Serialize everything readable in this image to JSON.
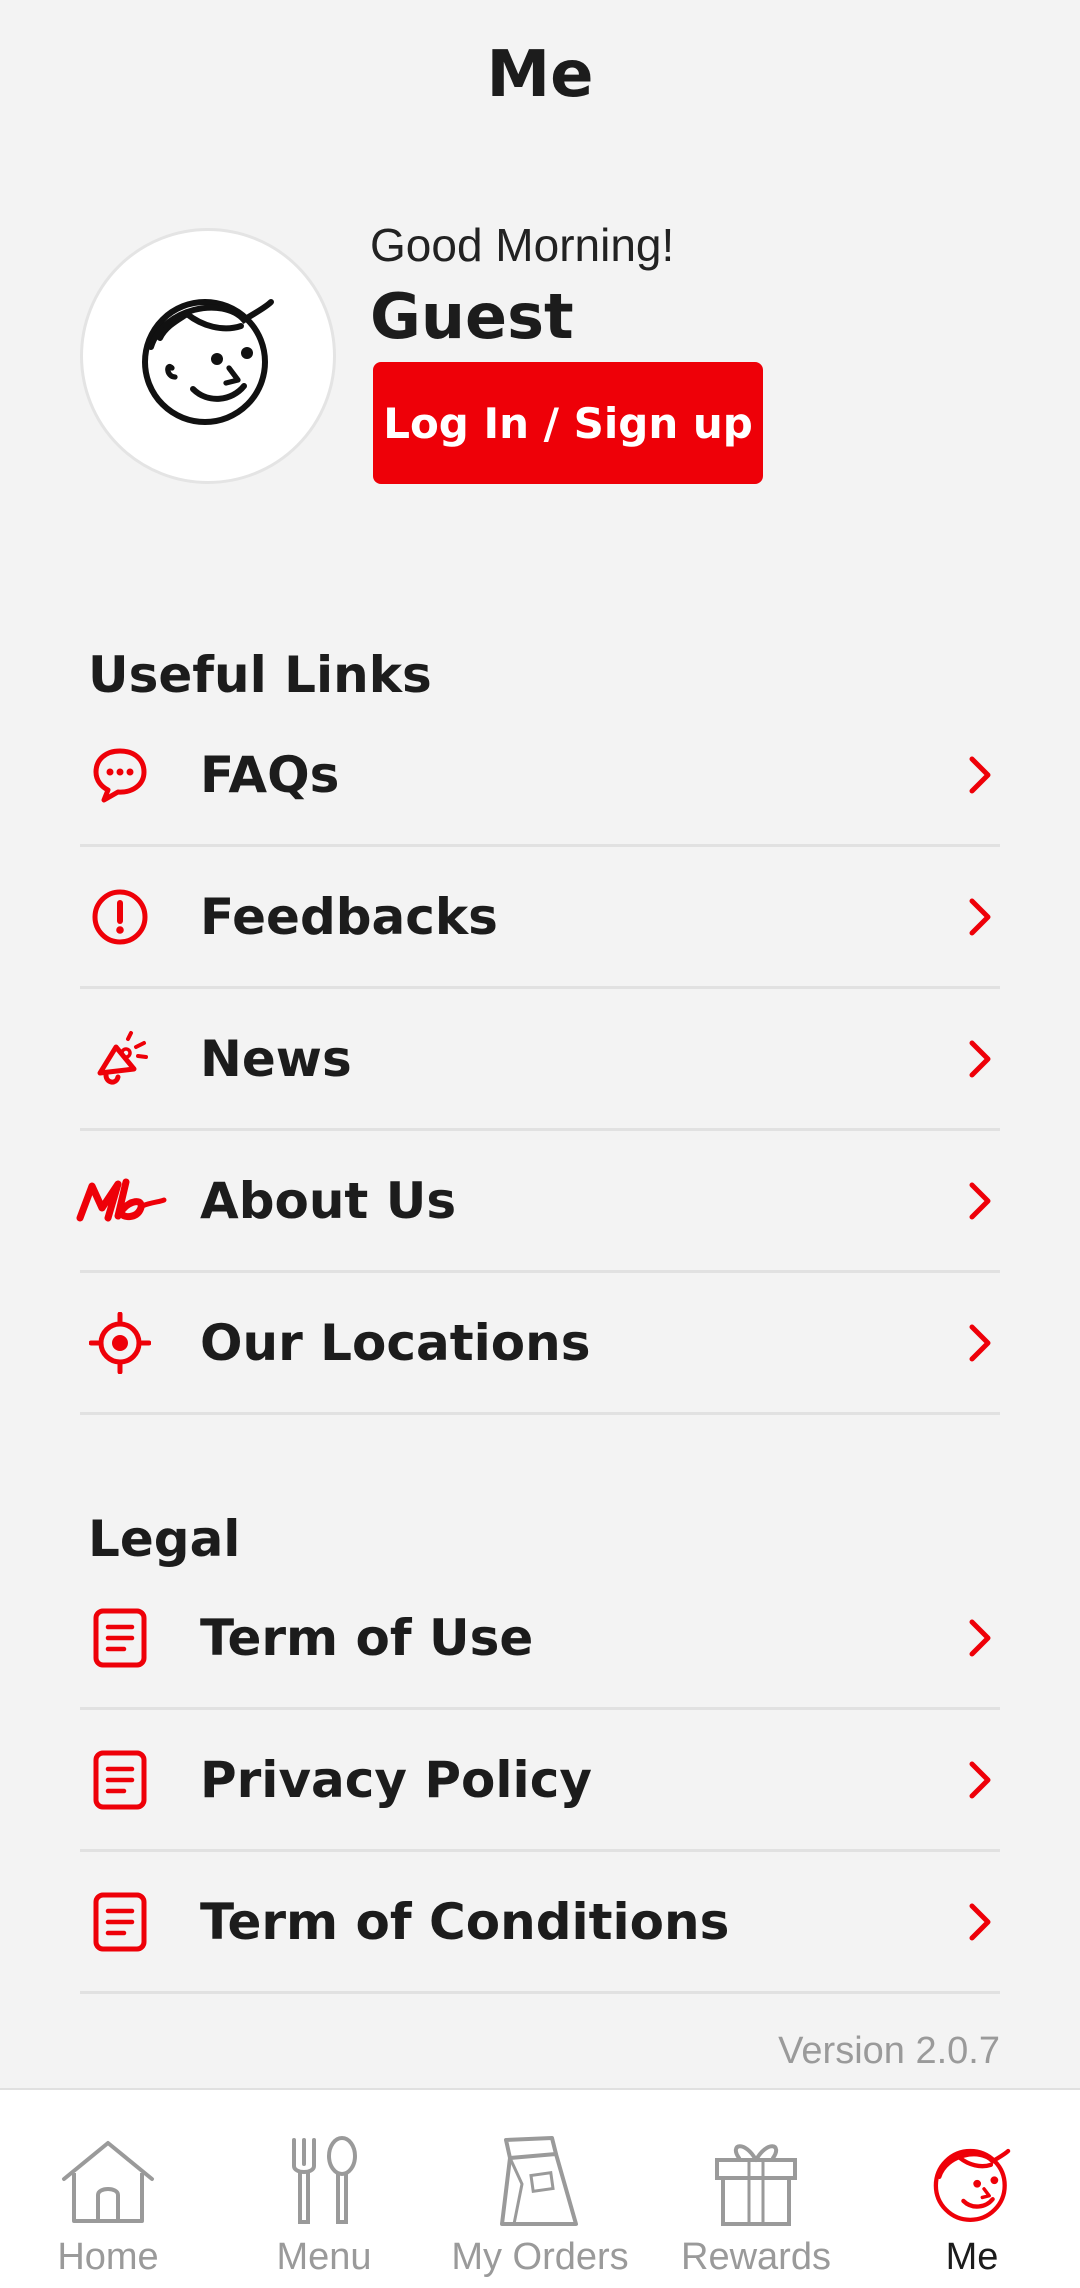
{
  "header": {
    "title": "Me"
  },
  "profile": {
    "greeting": "Good Morning!",
    "name": "Guest",
    "login_label": "Log In / Sign up",
    "avatar_icon": "mascot-face-icon"
  },
  "useful_links": {
    "title": "Useful Links",
    "items": [
      {
        "label": "FAQs",
        "icon": "chat-bubble-icon"
      },
      {
        "label": "Feedbacks",
        "icon": "exclamation-circle-icon"
      },
      {
        "label": "News",
        "icon": "megaphone-icon"
      },
      {
        "label": "About Us",
        "icon": "brand-logo-icon"
      },
      {
        "label": "Our Locations",
        "icon": "location-target-icon"
      }
    ]
  },
  "legal": {
    "title": "Legal",
    "items": [
      {
        "label": "Term of Use",
        "icon": "document-icon"
      },
      {
        "label": "Privacy Policy",
        "icon": "document-icon"
      },
      {
        "label": "Term of Conditions",
        "icon": "document-icon"
      }
    ]
  },
  "version": "Version 2.0.7",
  "bottom_nav": {
    "items": [
      {
        "label": "Home",
        "icon": "house-icon"
      },
      {
        "label": "Menu",
        "icon": "fork-spoon-icon"
      },
      {
        "label": "My Orders",
        "icon": "bag-icon"
      },
      {
        "label": "Rewards",
        "icon": "gift-icon"
      },
      {
        "label": "Me",
        "icon": "mascot-face-icon"
      }
    ],
    "active": "Me"
  },
  "colors": {
    "accent": "#ee0008",
    "background": "#f3f3f3",
    "inactive": "#9a9a9a"
  }
}
